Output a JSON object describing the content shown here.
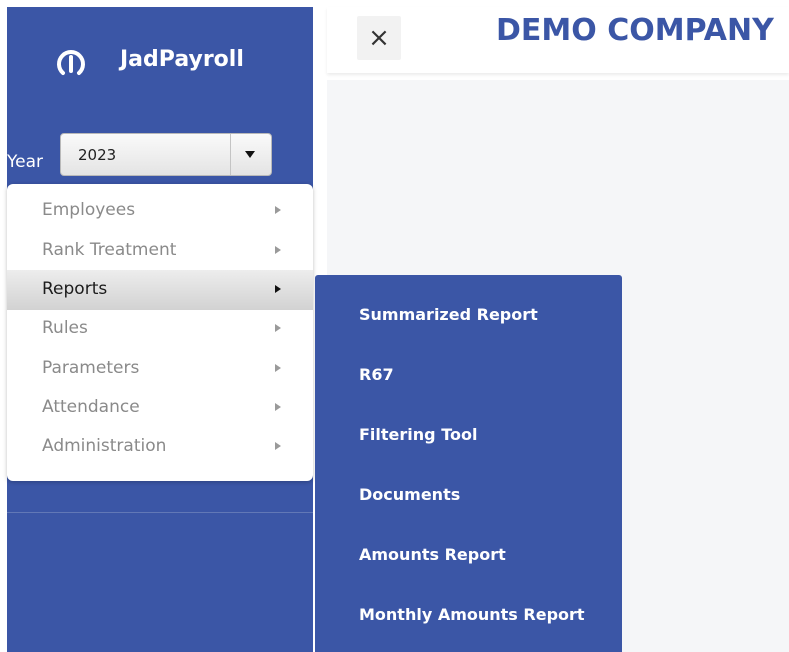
{
  "app": {
    "name": "JadPayroll",
    "company": "DEMO COMPANY"
  },
  "header": {
    "close_label": "×"
  },
  "year": {
    "label": "Year",
    "selected": "2023"
  },
  "menu": {
    "items": [
      {
        "label": "Employees"
      },
      {
        "label": "Rank Treatment"
      },
      {
        "label": "Reports"
      },
      {
        "label": "Rules"
      },
      {
        "label": "Parameters"
      },
      {
        "label": "Attendance"
      },
      {
        "label": "Administration"
      }
    ],
    "active": "Reports"
  },
  "submenu": {
    "items": [
      {
        "label": "Summarized Report"
      },
      {
        "label": "R67"
      },
      {
        "label": "Filtering Tool"
      },
      {
        "label": "Documents"
      },
      {
        "label": "Amounts Report"
      },
      {
        "label": "Monthly Amounts Report"
      }
    ]
  },
  "colors": {
    "brand": "#3b56a6",
    "menu_text": "#8a8a8a",
    "active_bg": "#dedede"
  },
  "icons": {
    "logo": "power-gauge-icon",
    "submenu_arrow": "caret-right-icon",
    "dropdown": "caret-down-icon",
    "close": "close-icon"
  }
}
